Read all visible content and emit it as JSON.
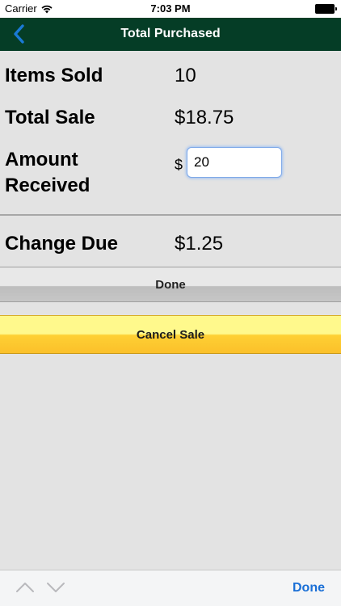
{
  "status_bar": {
    "carrier": "Carrier",
    "time": "7:03 PM"
  },
  "nav": {
    "title": "Total Purchased"
  },
  "rows": {
    "items_sold": {
      "label": "Items Sold",
      "value": "10"
    },
    "total_sale": {
      "label": "Total Sale",
      "value": "$18.75"
    },
    "amount_received": {
      "label_line1": "Amount",
      "label_line2": "Received",
      "currency": "$",
      "value": "20"
    },
    "change_due": {
      "label": "Change Due",
      "value": "$1.25"
    }
  },
  "buttons": {
    "done": "Done",
    "cancel_sale": "Cancel Sale"
  },
  "keyboard_accessory": {
    "done": "Done"
  },
  "colors": {
    "nav_background": "#053d26",
    "back_chevron": "#1a7ad6",
    "cancel_yellow": "#fed034",
    "accessory_done": "#1a6fd6"
  },
  "icons": {
    "back": "chevron-left-icon",
    "wifi": "wifi-icon",
    "battery": "battery-icon",
    "prev_field": "chevron-up-icon",
    "next_field": "chevron-down-icon"
  }
}
